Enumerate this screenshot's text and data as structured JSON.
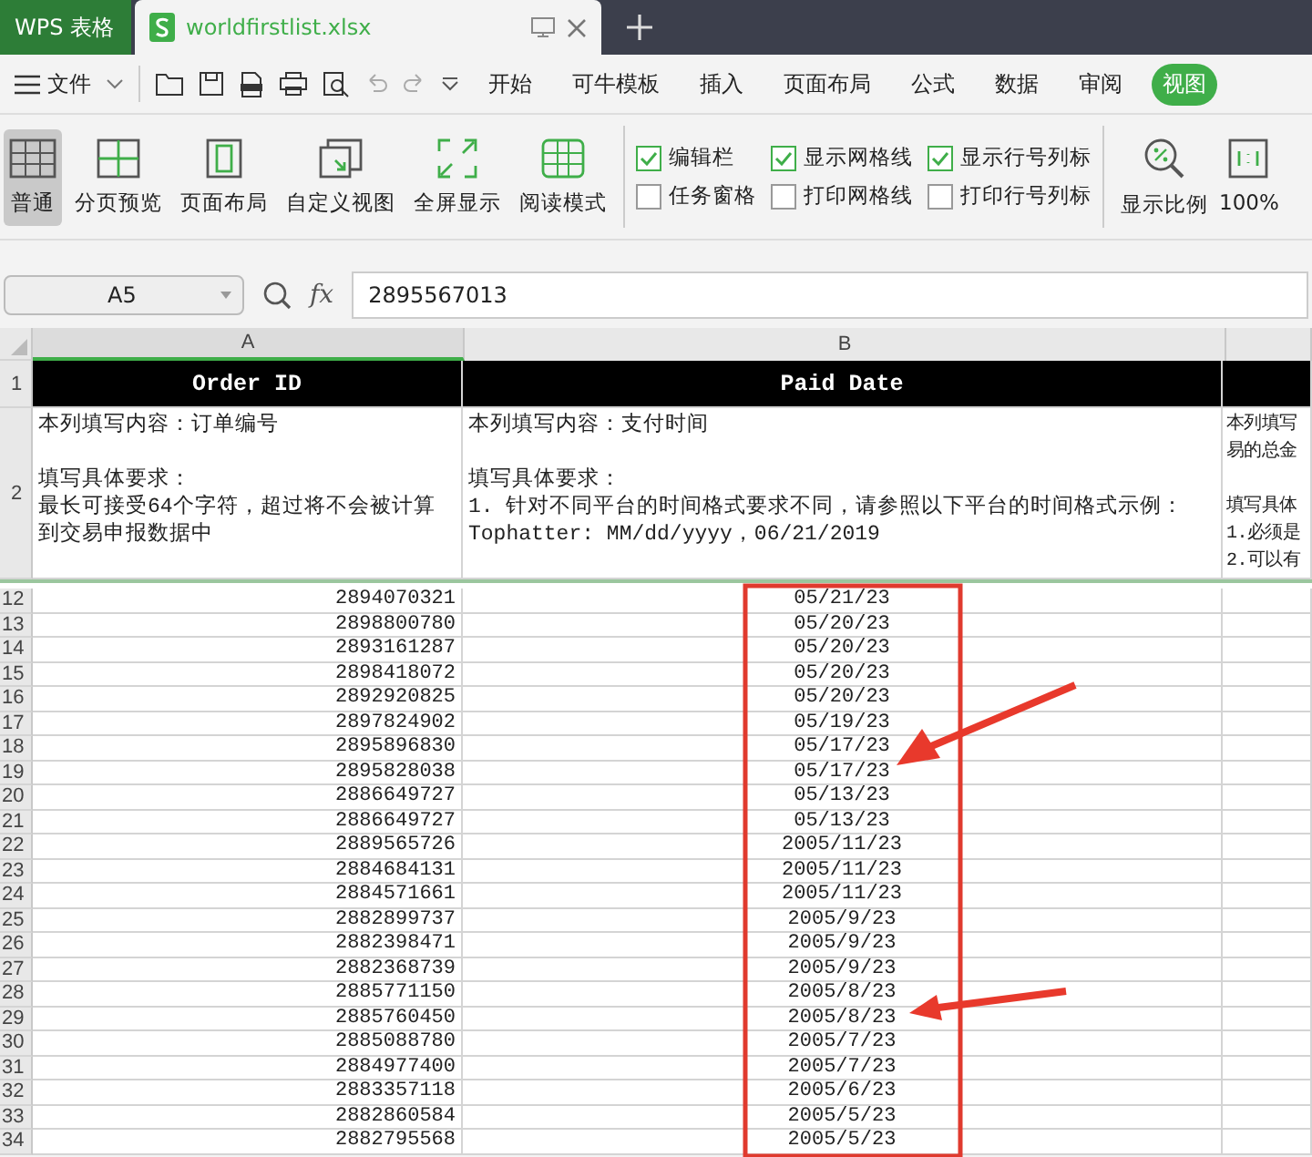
{
  "app_tabs": [
    {
      "label": "WPS 表格",
      "kind": "home",
      "selected": false
    },
    {
      "label": "worldfirstlist.xlsx",
      "kind": "doc",
      "selected": true
    }
  ],
  "menu": {
    "file": "文件",
    "tabs": [
      {
        "label": "开始",
        "selected": false
      },
      {
        "label": "可牛模板",
        "selected": false
      },
      {
        "label": "插入",
        "selected": false
      },
      {
        "label": "页面布局",
        "selected": false
      },
      {
        "label": "公式",
        "selected": false
      },
      {
        "label": "数据",
        "selected": false
      },
      {
        "label": "审阅",
        "selected": false
      },
      {
        "label": "视图",
        "selected": true
      }
    ]
  },
  "ribbon": {
    "view_buttons": [
      {
        "label": "普通",
        "kind": "normal",
        "selected": true
      },
      {
        "label": "分页预览",
        "kind": "pagebreak",
        "selected": false
      },
      {
        "label": "页面布局",
        "kind": "layout",
        "selected": false
      },
      {
        "label": "自定义视图",
        "kind": "custom",
        "selected": false
      },
      {
        "label": "全屏显示",
        "kind": "fullscreen",
        "selected": false
      },
      {
        "label": "阅读模式",
        "kind": "reading",
        "selected": false
      }
    ],
    "checkboxes": [
      {
        "label": "编辑栏",
        "checked": true
      },
      {
        "label": "任务窗格",
        "checked": false
      },
      {
        "label": "显示网格线",
        "checked": true
      },
      {
        "label": "打印网格线",
        "checked": false
      },
      {
        "label": "显示行号列标",
        "checked": true
      },
      {
        "label": "打印行号列标",
        "checked": false
      }
    ],
    "zoom_buttons": [
      {
        "label": "显示比例",
        "kind": "zoom"
      },
      {
        "label": "100%",
        "kind": "actual"
      }
    ]
  },
  "formula_bar": {
    "cell_ref": "A5",
    "fx": "fx",
    "value": "2895567013"
  },
  "sheet": {
    "columns": [
      "A",
      "B"
    ],
    "header_row": {
      "number": "1",
      "cells": [
        "Order ID",
        "Paid Date"
      ]
    },
    "note_row": {
      "number": "2",
      "cells": [
        [
          [
            "本列填写内容：订单编号"
          ],
          [
            "填写具体要求：",
            "最长可接受64个字符，超过将不会被计算",
            "到交易申报数据中"
          ]
        ],
        [
          [
            "本列填写内容：支付时间"
          ],
          [
            "填写具体要求：",
            "1. 针对不同平台的时间格式要求不同，请参照以下平台的时间格式示例：",
            "Tophatter: MM/dd/yyyy，06/21/2019"
          ]
        ],
        [
          [
            "本列填写",
            "易的总金"
          ],
          [
            "填写具体",
            "1.必须是",
            "2.可以有"
          ]
        ]
      ]
    },
    "rows": [
      {
        "number": "12",
        "order_id": "2894070321",
        "paid_date": "05/21/23"
      },
      {
        "number": "13",
        "order_id": "2898800780",
        "paid_date": "05/20/23"
      },
      {
        "number": "14",
        "order_id": "2893161287",
        "paid_date": "05/20/23"
      },
      {
        "number": "15",
        "order_id": "2898418072",
        "paid_date": "05/20/23"
      },
      {
        "number": "16",
        "order_id": "2892920825",
        "paid_date": "05/20/23"
      },
      {
        "number": "17",
        "order_id": "2897824902",
        "paid_date": "05/19/23"
      },
      {
        "number": "18",
        "order_id": "2895896830",
        "paid_date": "05/17/23"
      },
      {
        "number": "19",
        "order_id": "2895828038",
        "paid_date": "05/17/23"
      },
      {
        "number": "20",
        "order_id": "2886649727",
        "paid_date": "05/13/23"
      },
      {
        "number": "21",
        "order_id": "2886649727",
        "paid_date": "05/13/23"
      },
      {
        "number": "22",
        "order_id": "2889565726",
        "paid_date": "2005/11/23"
      },
      {
        "number": "23",
        "order_id": "2884684131",
        "paid_date": "2005/11/23"
      },
      {
        "number": "24",
        "order_id": "2884571661",
        "paid_date": "2005/11/23"
      },
      {
        "number": "25",
        "order_id": "2882899737",
        "paid_date": "2005/9/23"
      },
      {
        "number": "26",
        "order_id": "2882398471",
        "paid_date": "2005/9/23"
      },
      {
        "number": "27",
        "order_id": "2882368739",
        "paid_date": "2005/9/23"
      },
      {
        "number": "28",
        "order_id": "2885771150",
        "paid_date": "2005/8/23"
      },
      {
        "number": "29",
        "order_id": "2885760450",
        "paid_date": "2005/8/23"
      },
      {
        "number": "30",
        "order_id": "2885088780",
        "paid_date": "2005/7/23"
      },
      {
        "number": "31",
        "order_id": "2884977400",
        "paid_date": "2005/7/23"
      },
      {
        "number": "32",
        "order_id": "2883357118",
        "paid_date": "2005/6/23"
      },
      {
        "number": "33",
        "order_id": "2882860584",
        "paid_date": "2005/5/23"
      },
      {
        "number": "34",
        "order_id": "2882795568",
        "paid_date": "2005/5/23"
      }
    ]
  }
}
